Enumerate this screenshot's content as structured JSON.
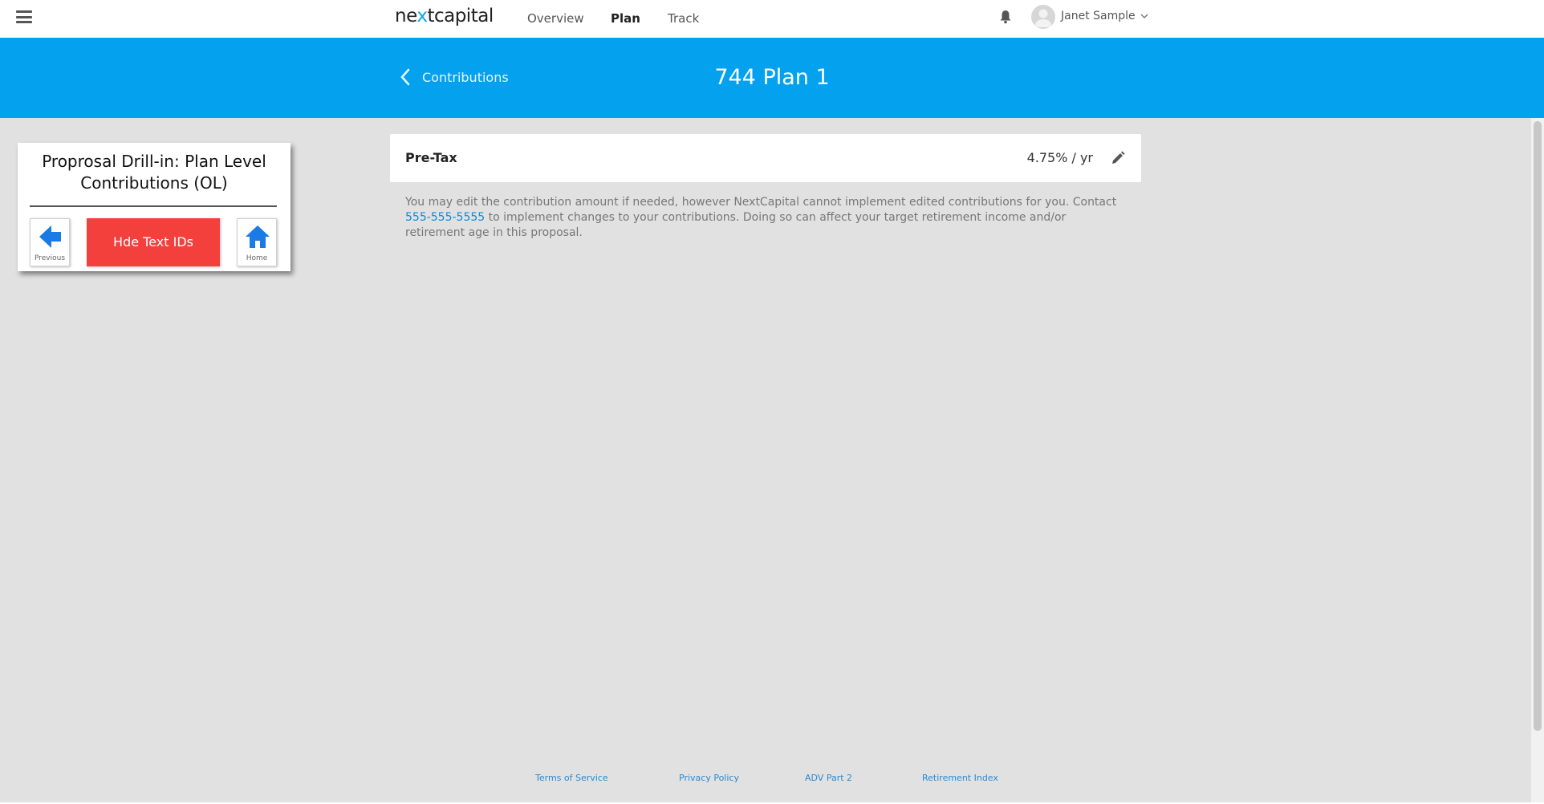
{
  "app": {
    "logo_text_pre": "ne",
    "logo_text_x": "x",
    "logo_text_post": "tcapital"
  },
  "nav": {
    "items": [
      {
        "label": "Overview"
      },
      {
        "label": "Plan",
        "active": true
      },
      {
        "label": "Track"
      }
    ],
    "user_name": "Janet Sample"
  },
  "header": {
    "back_label": "Contributions",
    "title": "744 Plan 1"
  },
  "card": {
    "label": "Pre-Tax",
    "value": "4.75% / yr"
  },
  "disclaimer": {
    "text_before": "You may edit the contribution amount if needed, however NextCapital cannot implement edited contributions for you. Contact ",
    "phone": "555-555-5555",
    "text_after": " to implement changes to your contributions. Doing so can affect your target retirement income and/or retirement age in this proposal."
  },
  "footer": {
    "links": [
      "Terms of Service",
      "Privacy Policy",
      "ADV Part 2",
      "Retirement Index"
    ]
  },
  "overlay": {
    "title": "Proprosal Drill-in: Plan Level Contributions (OL)",
    "previous_label": "Previous",
    "toggle_label": "Hde Text IDs",
    "home_label": "Home"
  },
  "colors": {
    "brand_blue": "#03a1ee",
    "link_blue": "#0a8ad6",
    "alert_red": "#f3403d",
    "icon_blue": "#1a7be6",
    "background_gray": "#e1e1e1"
  },
  "icons": [
    "menu-icon",
    "bell-icon",
    "avatar-icon",
    "chevron-down-icon",
    "chevron-left-icon",
    "pencil-icon",
    "arrow-left-icon",
    "home-icon"
  ]
}
